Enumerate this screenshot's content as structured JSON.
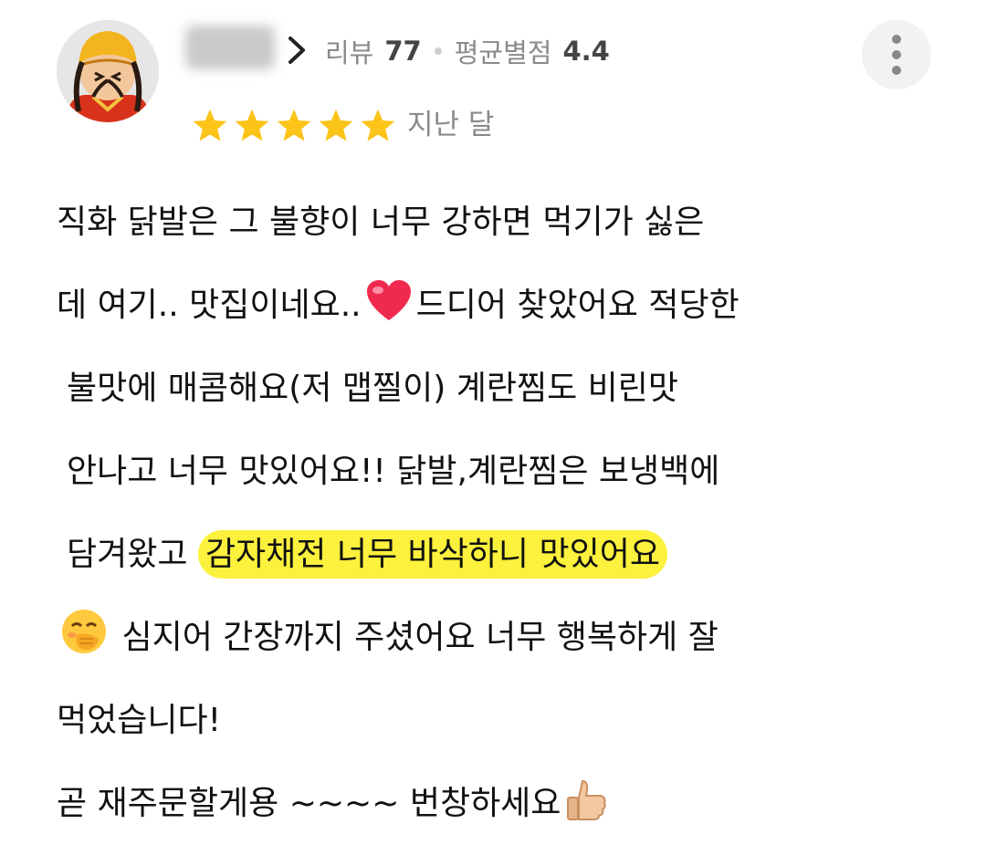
{
  "header": {
    "reviewer": {
      "username": "",
      "review_label": "리뷰",
      "review_count": "77",
      "rating_label": "평균별점",
      "avg_rating": "4.4"
    },
    "rating_stars": 5,
    "date_text": "지난 달"
  },
  "review": {
    "line1": "직화 닭발은 그 불향이 너무 강하면 먹기가 싫은",
    "line2_a": "데 여기.. 맛집이네요..",
    "line2_b": "드디어 찾았어요 적당한",
    "line3": "불맛에 매콤해요(저 맵찔이) 계란찜도 비린맛",
    "line4": "안나고 너무 맛있어요!! 닭발,계란찜은 보냉백에",
    "line5_a": "담겨왔고",
    "line5_highlight": "감자채전 너무 바삭하니 맛있어요",
    "line6": "심지어 간장까지 주셨어요 너무 행복하게 잘",
    "line7": "먹었습니다!",
    "line8": "곧 재주문할게용 ~~~~ 번창하세요"
  },
  "icons": {
    "avatar": "avatar-character-icon",
    "chevron": "chevron-right-icon",
    "more": "more-vertical-icon",
    "star": "star-icon",
    "heart": "heart-emoji",
    "giggle": "face-with-hand-over-mouth-emoji",
    "thumbs": "thumbs-up-emoji"
  },
  "colors": {
    "star": "#fcc419",
    "highlight": "#fcf13c",
    "meta_text": "#8a8a8a",
    "heart": "#f0294f"
  }
}
